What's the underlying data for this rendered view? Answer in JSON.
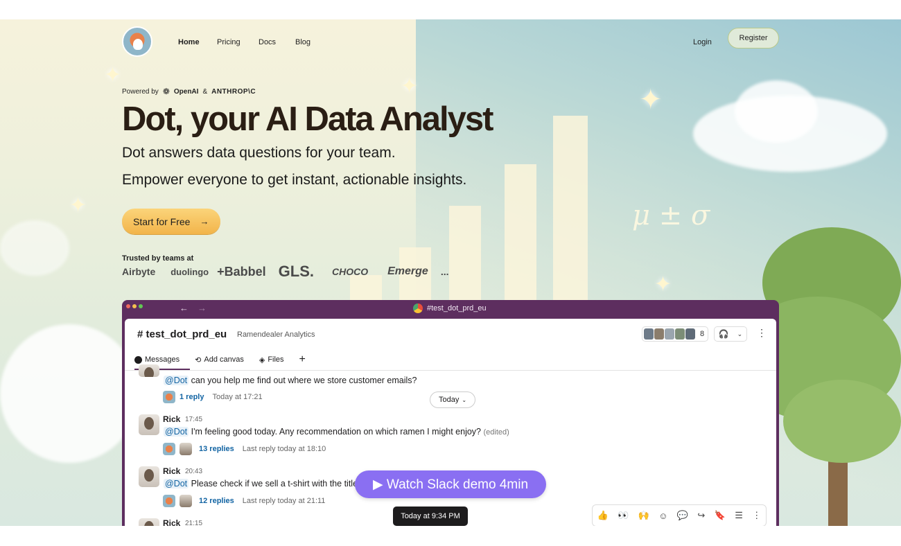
{
  "nav": {
    "links": [
      "Home",
      "Pricing",
      "Docs",
      "Blog"
    ],
    "login": "Login",
    "register": "Register"
  },
  "hero": {
    "powered_by": "Powered by",
    "openai": "OpenAI",
    "amp": "&",
    "anthropic": "ANTHROP\\C",
    "title": "Dot, your AI Data Analyst",
    "subtitle1": "Dot answers data questions for your team.",
    "subtitle2": "Empower everyone to get instant, actionable insights.",
    "cta": "Start for Free",
    "cta_arrow": "→",
    "trusted": "Trusted by teams at",
    "logos": [
      "Airbyte",
      "duolingo",
      "+Babbel",
      "GLS.",
      "CHOCO",
      "Emerge",
      "..."
    ],
    "formula": "μ ± σ"
  },
  "slack": {
    "window_title": "#test_dot_prd_eu",
    "back": "←",
    "forward": "→",
    "channel": "# test_dot_prd_eu",
    "channel_sub": "Ramendealer Analytics",
    "member_count": "8",
    "tabs": [
      "Messages",
      "Add canvas",
      "Files",
      "+"
    ],
    "today_pill": "Today",
    "messages": [
      {
        "name": "",
        "time": "",
        "mention": "@Dot",
        "text": "can you help me find out where we store customer emails?",
        "replies": "1 reply",
        "last": "Today at 17:21"
      },
      {
        "name": "Rick",
        "time": "17:45",
        "mention": "@Dot",
        "text": "I'm feeling good today. Any recommendation on which ramen I might enjoy?",
        "edited": "(edited)",
        "replies": "13 replies",
        "last": "Last reply today at 18:10"
      },
      {
        "name": "Rick",
        "time": "20:43",
        "mention": "@Dot",
        "text": "Please check if we sell a t-shirt with the title",
        "replies": "12 replies",
        "last": "Last reply today at 21:11"
      },
      {
        "name": "Rick",
        "time": "21:15"
      }
    ],
    "demo_button": "▶ Watch Slack demo 4min",
    "tooltip": "Today at 9:34 PM",
    "actions": [
      "👍",
      "👀",
      "🙌",
      "☺",
      "💬",
      "↪",
      "🔖",
      "☰",
      "⋮"
    ]
  },
  "colors": {
    "cta": "#f2b44a",
    "slack_purple": "#5d2e5f",
    "demo": "#8a6ff2",
    "link": "#1264a3"
  }
}
